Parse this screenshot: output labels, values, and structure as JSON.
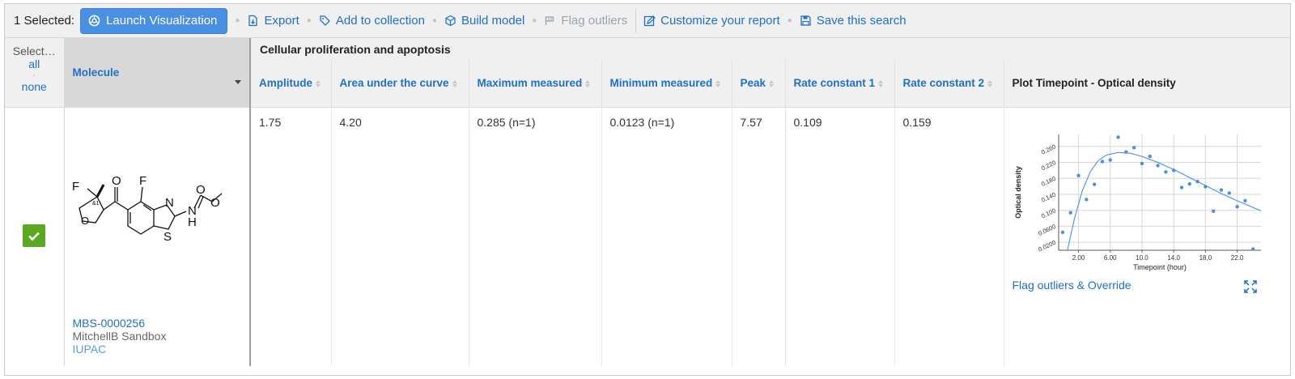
{
  "toolbar": {
    "selected": "1 Selected:",
    "launch": "Launch Visualization",
    "export": "Export",
    "add_collection": "Add to collection",
    "build_model": "Build model",
    "flag_outliers": "Flag outliers",
    "customize": "Customize your report",
    "save_search": "Save this search"
  },
  "table": {
    "select_label": "Select…",
    "select_all": "all",
    "select_dot": "·",
    "select_none": "none",
    "molecule_header": "Molecule",
    "group_header": "Cellular proliferation and apoptosis",
    "columns": [
      "Amplitude",
      "Area under the curve",
      "Maximum measured",
      "Minimum measured",
      "Peak",
      "Rate constant 1",
      "Rate constant 2"
    ],
    "plot_header": "Plot Timepoint - Optical density"
  },
  "row": {
    "molecule_id": "MBS-0000256",
    "molecule_source": "MitchellB Sandbox",
    "molecule_iupac": "IUPAC",
    "values": [
      "1.75",
      "4.20",
      "0.285 (n=1)",
      "0.0123 (n=1)",
      "7.57",
      "0.109",
      "0.159"
    ],
    "flag_link": "Flag outliers & Override"
  },
  "molecule_atoms": {
    "F1": "F",
    "F2": "F",
    "O_carbonyl": "O",
    "O_ring": "O",
    "N_ring": "N",
    "S_ring": "S",
    "N_H": "N",
    "H": "H",
    "O_carbamate1": "O",
    "O_carbamate2": "O",
    "stereo": "&1"
  },
  "colors": {
    "accent": "#1f6fc4",
    "launch_button": "#4a90e2",
    "check": "#5aa821",
    "plot_line": "#4a90e2"
  },
  "chart_data": {
    "type": "scatter",
    "xlabel": "Timepoint (hour)",
    "ylabel": "Optical density",
    "xticks": [
      "2.00",
      "6.00",
      "10.0",
      "14.0",
      "18.0",
      "22.0"
    ],
    "yticks": [
      "0.0200",
      "0.0600",
      "0.100",
      "0.140",
      "0.180",
      "0.220",
      "0.260"
    ],
    "xlim": [
      -0.5,
      25
    ],
    "ylim": [
      0.0,
      0.29
    ],
    "points": [
      {
        "x": 0.0,
        "y": 0.045
      },
      {
        "x": 1.0,
        "y": 0.094
      },
      {
        "x": 2.0,
        "y": 0.187
      },
      {
        "x": 3.0,
        "y": 0.127
      },
      {
        "x": 4.0,
        "y": 0.165
      },
      {
        "x": 5.0,
        "y": 0.222
      },
      {
        "x": 6.0,
        "y": 0.226
      },
      {
        "x": 7.0,
        "y": 0.283
      },
      {
        "x": 8.0,
        "y": 0.246
      },
      {
        "x": 9.0,
        "y": 0.257
      },
      {
        "x": 10.0,
        "y": 0.217
      },
      {
        "x": 11.0,
        "y": 0.235
      },
      {
        "x": 12.0,
        "y": 0.212
      },
      {
        "x": 13.0,
        "y": 0.196
      },
      {
        "x": 14.0,
        "y": 0.2
      },
      {
        "x": 15.0,
        "y": 0.157
      },
      {
        "x": 16.0,
        "y": 0.166
      },
      {
        "x": 17.0,
        "y": 0.172
      },
      {
        "x": 18.0,
        "y": 0.159
      },
      {
        "x": 19.0,
        "y": 0.098
      },
      {
        "x": 20.0,
        "y": 0.151
      },
      {
        "x": 21.0,
        "y": 0.143
      },
      {
        "x": 22.0,
        "y": 0.109
      },
      {
        "x": 23.0,
        "y": 0.124
      },
      {
        "x": 24.0,
        "y": 0.003
      }
    ],
    "fit_curve": [
      {
        "x": 0.6,
        "y": 0.0
      },
      {
        "x": 1.5,
        "y": 0.08
      },
      {
        "x": 2.5,
        "y": 0.15
      },
      {
        "x": 3.5,
        "y": 0.197
      },
      {
        "x": 4.5,
        "y": 0.225
      },
      {
        "x": 5.5,
        "y": 0.238
      },
      {
        "x": 7.0,
        "y": 0.245
      },
      {
        "x": 8.5,
        "y": 0.243
      },
      {
        "x": 10.0,
        "y": 0.235
      },
      {
        "x": 12.0,
        "y": 0.22
      },
      {
        "x": 14.0,
        "y": 0.202
      },
      {
        "x": 16.0,
        "y": 0.182
      },
      {
        "x": 18.0,
        "y": 0.162
      },
      {
        "x": 20.0,
        "y": 0.142
      },
      {
        "x": 22.0,
        "y": 0.124
      },
      {
        "x": 24.0,
        "y": 0.107
      },
      {
        "x": 25.0,
        "y": 0.099
      }
    ],
    "grid": true
  }
}
